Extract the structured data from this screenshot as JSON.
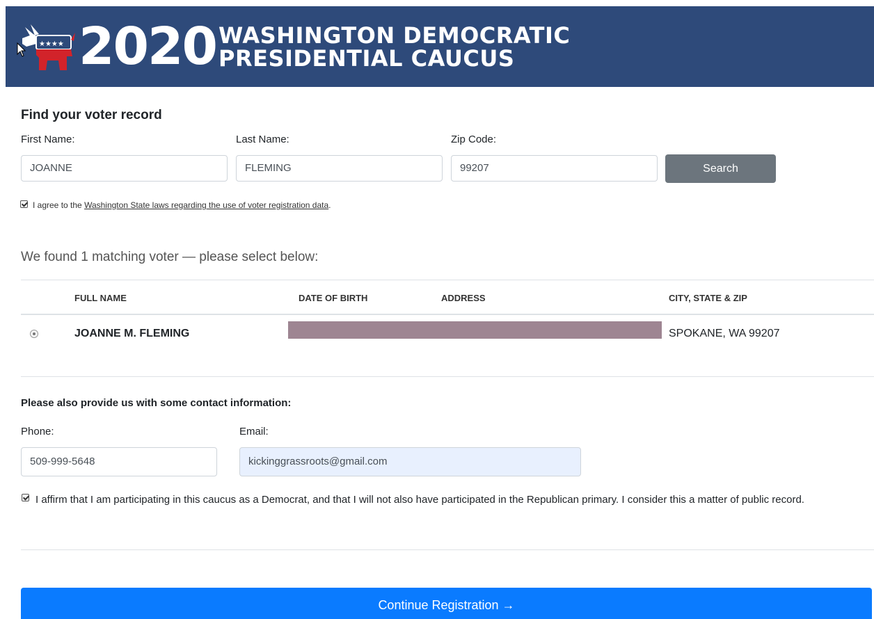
{
  "header": {
    "year": "2020",
    "title_line1": "WASHINGTON DEMOCRATIC",
    "title_line2": "PRESIDENTIAL CAUCUS",
    "logo_icon": "democratic-donkey-logo",
    "logo_stars": "★★★★"
  },
  "search": {
    "heading": "Find your voter record",
    "first_name_label": "First Name:",
    "first_name_value": "JOANNE",
    "last_name_label": "Last Name:",
    "last_name_value": "FLEMING",
    "zip_label": "Zip Code:",
    "zip_value": "99207",
    "search_button": "Search",
    "agree_prefix": "I agree to the ",
    "agree_link": "Washington State laws regarding the use of voter registration data",
    "agree_suffix": ".",
    "agree_checked": true
  },
  "results": {
    "summary": "We found 1 matching voter — please select below:",
    "columns": [
      "FULL NAME",
      "DATE OF BIRTH",
      "ADDRESS",
      "CITY, STATE & ZIP"
    ],
    "rows": [
      {
        "full_name": "JOANNE M. FLEMING",
        "date_of_birth": "",
        "address": "",
        "city_state_zip": "SPOKANE, WA 99207",
        "selected": true
      }
    ]
  },
  "contact": {
    "heading": "Please also provide us with some contact information:",
    "phone_label": "Phone:",
    "phone_value": "509-999-5648",
    "email_label": "Email:",
    "email_value": "kickinggrassroots@gmail.com",
    "affirm_text": "I affirm that I am participating in this caucus as a Democrat, and that I will not also have participated in the Republican primary. I consider this a matter of public record.",
    "affirm_checked": true
  },
  "footer": {
    "continue_button": "Continue Registration →"
  },
  "colors": {
    "banner": "#2e4a7a",
    "primary": "#0a7bff",
    "secondary": "#6c757d",
    "logo_red": "#d2232a",
    "logo_blue": "#2e4a7a"
  }
}
